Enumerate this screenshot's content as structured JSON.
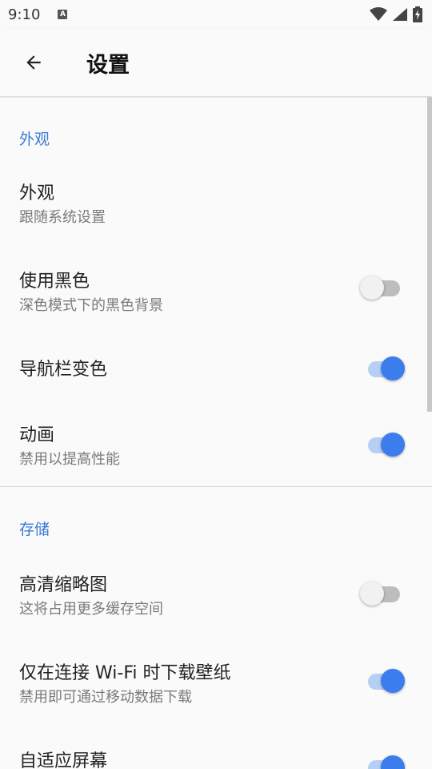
{
  "status_bar": {
    "time": "9:10",
    "notification_letter": "A"
  },
  "app_bar": {
    "title": "设置"
  },
  "sections": [
    {
      "header": "外观",
      "items": [
        {
          "title": "外观",
          "subtitle": "跟随系统设置"
        },
        {
          "title": "使用黑色",
          "subtitle": "深色模式下的黑色背景",
          "toggle": false
        },
        {
          "title": "导航栏变色",
          "toggle": true
        },
        {
          "title": "动画",
          "subtitle": "禁用以提高性能",
          "toggle": true
        }
      ]
    },
    {
      "header": "存储",
      "items": [
        {
          "title": "高清缩略图",
          "subtitle": "这将占用更多缓存空间",
          "toggle": false
        },
        {
          "title": "仅在连接 Wi-Fi 时下载壁纸",
          "subtitle": "禁用即可通过移动数据下载",
          "toggle": true
        },
        {
          "title": "自适应屏幕",
          "toggle": true
        }
      ]
    }
  ],
  "colors": {
    "accent": "#3b7ded",
    "section_header": "#3a7bd5",
    "background": "#fafafa"
  },
  "icons": {
    "back": "arrow-left-icon",
    "wifi": "wifi-icon",
    "signal": "cell-signal-icon",
    "battery": "battery-charging-icon"
  }
}
